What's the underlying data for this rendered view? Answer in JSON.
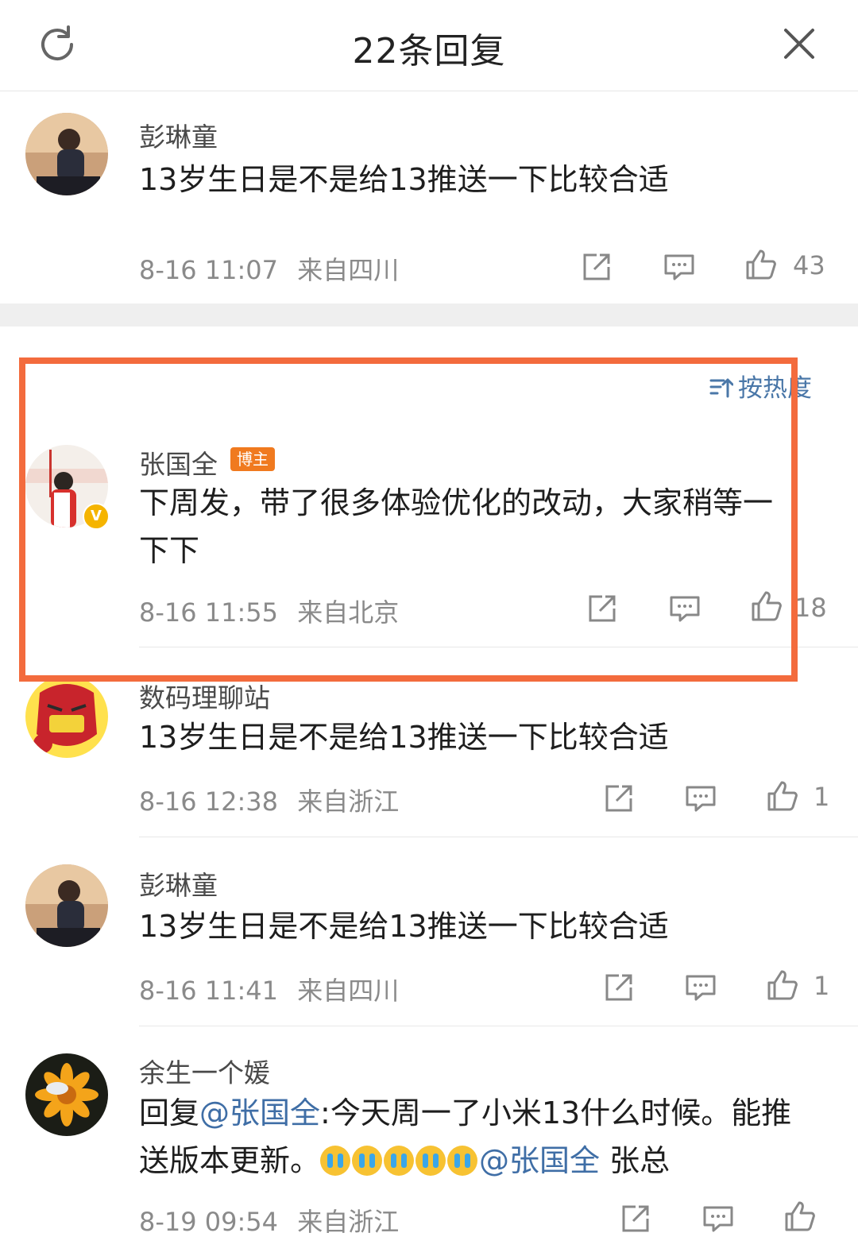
{
  "header": {
    "title": "22条回复",
    "refresh_icon": "refresh-icon",
    "close_icon": "close-icon"
  },
  "sort": {
    "label": "按热度"
  },
  "comments": [
    {
      "name": "彭琳童",
      "text": "13岁生日是不是给13推送一下比较合适",
      "time": "8-16 11:07",
      "location": "来自四川",
      "likes": "43"
    },
    {
      "name": "张国全",
      "badge": "博主",
      "text_line1": "下周发，带了很多体验优化的改动，大家稍等一",
      "text_line2": "下下",
      "time": "8-16 11:55",
      "location": "来自北京",
      "likes": "18"
    },
    {
      "name": "数码理聊站",
      "text": "13岁生日是不是给13推送一下比较合适",
      "time": "8-16 12:38",
      "location": "来自浙江",
      "likes": "1"
    },
    {
      "name": "彭琳童",
      "text": "13岁生日是不是给13推送一下比较合适",
      "time": "8-16 11:41",
      "location": "来自四川",
      "likes": "1"
    },
    {
      "name": "余生一个媛",
      "reply_prefix": "回复",
      "mention1": "@张国全",
      "line1_rest": ":今天周一了小米13什么时候。能推",
      "line2_start": "送版本更新。",
      "mention2": "@张国全",
      "line2_end": " 张总",
      "time": "8-19 09:54",
      "location": "来自浙江",
      "likes": ""
    }
  ],
  "colors": {
    "accent": "#f36b3d",
    "link": "#3f6ea6",
    "badge": "#f07a1f",
    "meta": "#8a8a8a"
  }
}
